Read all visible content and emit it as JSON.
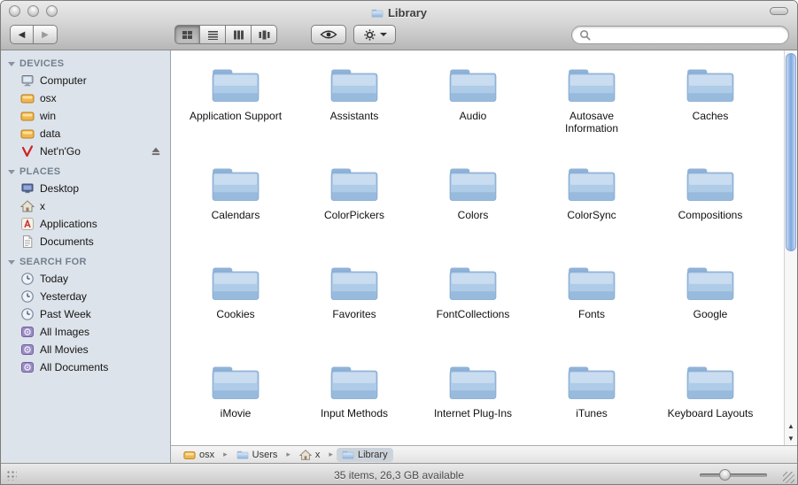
{
  "window": {
    "title": "Library",
    "status_text": "35 items, 26,3 GB available"
  },
  "toolbar": {
    "view_modes": [
      "icon-view",
      "list-view",
      "column-view",
      "coverflow-view"
    ],
    "active_view": "icon-view",
    "search": {
      "value": "",
      "placeholder": ""
    }
  },
  "icons": {
    "back-glyph": "◀",
    "forward-glyph": "▶",
    "path-separator": "▸",
    "scroll-up": "▲",
    "scroll-down": "▼"
  },
  "colors": {
    "folder_blue": "#aecbe8",
    "sidebar_background": "#dde3ea",
    "scrollbar_thumb_blue": "#7ea7df",
    "smart_folder_purple": "#9b8cc4",
    "drive_orange": "#f0b64f"
  },
  "sidebar": {
    "sections": [
      {
        "label": "DEVICES",
        "items": [
          {
            "label": "Computer",
            "icon": "computer-icon"
          },
          {
            "label": "osx",
            "icon": "drive-icon"
          },
          {
            "label": "win",
            "icon": "drive-icon"
          },
          {
            "label": "data",
            "icon": "drive-icon"
          },
          {
            "label": "Net'n'Go",
            "icon": "network-drive-icon",
            "eject": true
          }
        ]
      },
      {
        "label": "PLACES",
        "items": [
          {
            "label": "Desktop",
            "icon": "desktop-icon"
          },
          {
            "label": "x",
            "icon": "home-icon"
          },
          {
            "label": "Applications",
            "icon": "applications-icon"
          },
          {
            "label": "Documents",
            "icon": "documents-icon"
          }
        ]
      },
      {
        "label": "SEARCH FOR",
        "items": [
          {
            "label": "Today",
            "icon": "clock-icon"
          },
          {
            "label": "Yesterday",
            "icon": "clock-icon"
          },
          {
            "label": "Past Week",
            "icon": "clock-icon"
          },
          {
            "label": "All Images",
            "icon": "smart-folder-icon"
          },
          {
            "label": "All Movies",
            "icon": "smart-folder-icon"
          },
          {
            "label": "All Documents",
            "icon": "smart-folder-icon"
          }
        ]
      }
    ]
  },
  "main": {
    "folders": [
      "Application Support",
      "Assistants",
      "Audio",
      "Autosave Information",
      "Caches",
      "Calendars",
      "ColorPickers",
      "Colors",
      "ColorSync",
      "Compositions",
      "Cookies",
      "Favorites",
      "FontCollections",
      "Fonts",
      "Google",
      "iMovie",
      "Input Methods",
      "Internet Plug-Ins",
      "iTunes",
      "Keyboard Layouts"
    ]
  },
  "pathbar": {
    "items": [
      {
        "label": "osx",
        "icon": "drive-icon"
      },
      {
        "label": "Users",
        "icon": "folder-icon"
      },
      {
        "label": "x",
        "icon": "home-icon"
      },
      {
        "label": "Library",
        "icon": "folder-icon",
        "current": true
      }
    ]
  }
}
